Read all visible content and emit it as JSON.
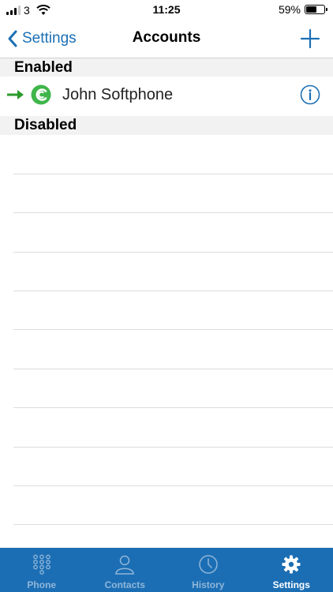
{
  "status_bar": {
    "carrier": "3",
    "time": "11:25",
    "battery": "59%",
    "battery_level": 0.59
  },
  "nav": {
    "back_label": "Settings",
    "title": "Accounts"
  },
  "sections": {
    "enabled": "Enabled",
    "disabled": "Disabled"
  },
  "accounts": [
    {
      "name": "John Softphone",
      "status": "enabled",
      "default": true
    }
  ],
  "tabs": [
    {
      "label": "Phone",
      "icon": "keypad-icon",
      "active": false
    },
    {
      "label": "Contacts",
      "icon": "person-icon",
      "active": false
    },
    {
      "label": "History",
      "icon": "clock-icon",
      "active": false
    },
    {
      "label": "Settings",
      "icon": "gear-icon",
      "active": true
    }
  ],
  "colors": {
    "accent": "#1b6fb4",
    "tab_bar": "#1c6eb4",
    "account_green": "#3fb54a",
    "arrow_green": "#2a9a2a"
  }
}
